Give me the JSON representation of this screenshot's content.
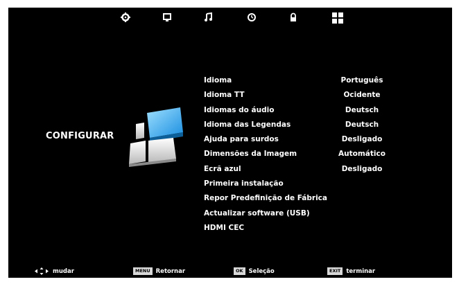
{
  "tabs": [
    {
      "icon": "gear-icon"
    },
    {
      "icon": "monitor-icon"
    },
    {
      "icon": "music-note-icon"
    },
    {
      "icon": "clock-icon"
    },
    {
      "icon": "lock-icon"
    },
    {
      "icon": "grid-icon",
      "selected": true
    }
  ],
  "section_title": "CONFIGURAR",
  "menu": [
    {
      "label": "Idioma",
      "value": "Português"
    },
    {
      "label": "Idioma TT",
      "value": "Ocidente"
    },
    {
      "label": "Idiomas do áudio",
      "value": "Deutsch"
    },
    {
      "label": "Idioma das Legendas",
      "value": "Deutsch"
    },
    {
      "label": "Ajuda para surdos",
      "value": "Desligado"
    },
    {
      "label": "Dimensões da Imagem",
      "value": "Automático"
    },
    {
      "label": "Ecrã azul",
      "value": "Desligado"
    },
    {
      "label": "Primeira instalação",
      "value": ""
    },
    {
      "label": "Repor Predefinição de Fábrica",
      "value": ""
    },
    {
      "label": "Actualizar software (USB)",
      "value": ""
    },
    {
      "label": "HDMI CEC",
      "value": ""
    }
  ],
  "legend": {
    "move_label": "mudar",
    "back_key": "MENU",
    "back_label": "Retornar",
    "ok_key": "OK",
    "ok_label": "Seleção",
    "exit_key": "EXIT",
    "exit_label": "terminar"
  },
  "colors": {
    "background": "#000000",
    "text": "#ffffff",
    "logo_accent": "#3ab0f0"
  }
}
